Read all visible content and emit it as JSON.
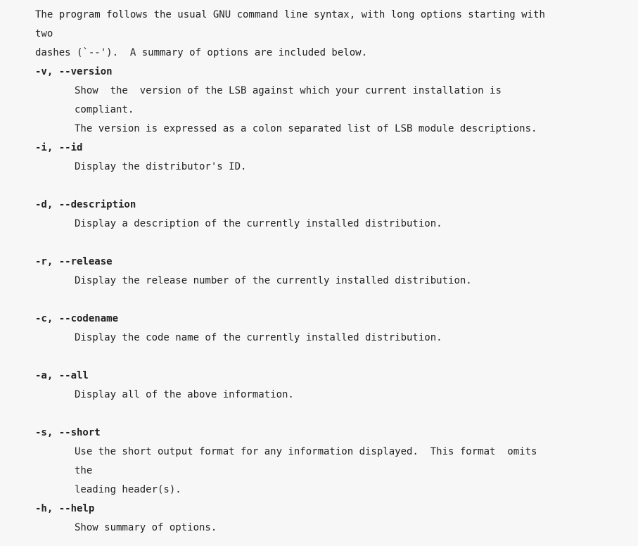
{
  "intro": "The program follows the usual GNU command line syntax, with long options starting with two\ndashes (`--').  A summary of options are included below.",
  "options": [
    {
      "flag": "-v, --version",
      "description": "Show  the  version of the LSB against which your current installation is compliant.\nThe version is expressed as a colon separated list of LSB module descriptions."
    },
    {
      "flag": "-i, --id",
      "description": "Display the distributor's ID."
    },
    {
      "flag": "-d, --description",
      "description": "Display a description of the currently installed distribution."
    },
    {
      "flag": "-r, --release",
      "description": "Display the release number of the currently installed distribution."
    },
    {
      "flag": "-c, --codename",
      "description": "Display the code name of the currently installed distribution."
    },
    {
      "flag": "-a, --all",
      "description": "Display all of the above information."
    },
    {
      "flag": "-s, --short",
      "description": "Use the short output format for any information displayed.  This format  omits  the\nleading header(s)."
    },
    {
      "flag": "-h, --help",
      "description": "Show summary of options."
    }
  ]
}
